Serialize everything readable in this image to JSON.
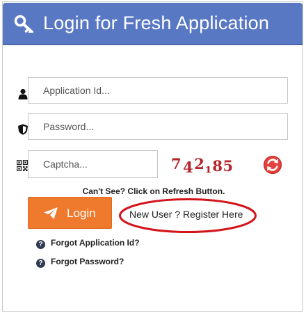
{
  "header": {
    "title": "Login for Fresh Application",
    "icon": "key-icon",
    "background": "#5978c4"
  },
  "form": {
    "application_id": {
      "placeholder": "Application Id...",
      "value": "",
      "icon": "user-icon"
    },
    "password": {
      "placeholder": "Password...",
      "value": "",
      "icon": "shield-icon"
    },
    "captcha": {
      "placeholder": "Captcha...",
      "value": "",
      "icon": "qr-code-icon"
    },
    "captcha_chars": [
      "7",
      "4",
      "2",
      "1",
      "8",
      "5"
    ],
    "captcha_color": "#b5232b",
    "refresh_icon": "refresh-icon",
    "cant_see_text": "Can't See? Click on Refresh Button."
  },
  "actions": {
    "login_label": "Login",
    "login_color": "#ef7a2e",
    "register_text": "New User ? Register Here",
    "register_highlight_color": "#d3141b"
  },
  "links": {
    "forgot_application_id": "Forgot Application Id?",
    "forgot_password": "Forgot Password?",
    "help_icon": "question-circle-icon"
  }
}
